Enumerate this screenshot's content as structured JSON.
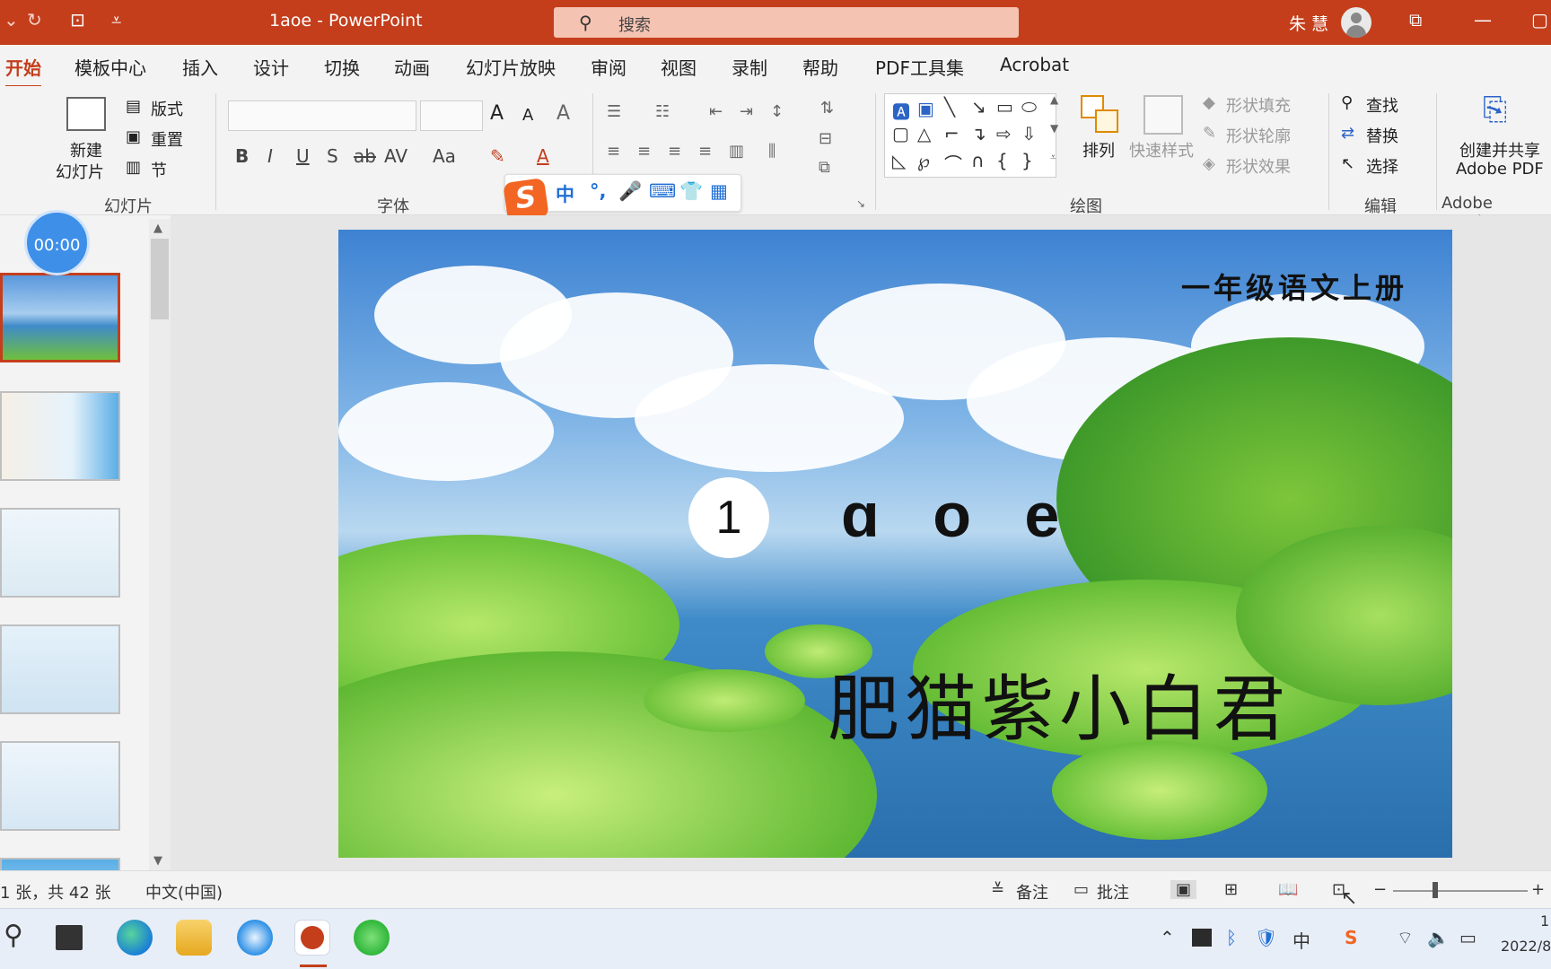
{
  "titlebar": {
    "doc_title": "1aoe  -  PowerPoint",
    "search_placeholder": "搜索",
    "user_name": "朱 慧",
    "undo_icon": "undo-icon",
    "redo_icon": "redo-icon"
  },
  "tabs": [
    "开始",
    "模板中心",
    "插入",
    "设计",
    "切换",
    "动画",
    "幻灯片放映",
    "审阅",
    "视图",
    "录制",
    "帮助",
    "PDF工具集",
    "Acrobat"
  ],
  "ribbon": {
    "slides": {
      "new_slide": "新建",
      "new_slide2": "幻灯片",
      "layout": "版式",
      "reset": "重置",
      "section": "节",
      "group": "幻灯片"
    },
    "font": {
      "group": "字体",
      "bold": "B",
      "italic": "I",
      "underline": "U",
      "shadow": "S",
      "strike": "ab",
      "spacing": "AV",
      "case": "Aa",
      "grow": "A",
      "shrink": "A",
      "clear": "A"
    },
    "drawing": {
      "group": "绘图",
      "arrange": "排列",
      "quick_styles": "快速样式",
      "fill": "形状填充",
      "outline": "形状轮廓",
      "effects": "形状效果"
    },
    "editing": {
      "group": "编辑",
      "find": "查找",
      "replace": "替换",
      "select": "选择"
    },
    "adobe": {
      "create_share": "创建并共享",
      "adobe_pdf": "Adobe PDF",
      "group": "Adobe Acroba"
    }
  },
  "ime": {
    "logo": "S",
    "mode": "中",
    "punct": "°,",
    "voice": "🎤",
    "keyboard": "⌨",
    "skin": "👕",
    "tools": "▦"
  },
  "timer": "00:00",
  "slide": {
    "subtitle": "一年级语文上册",
    "number": "1",
    "letters": "ɑ o e",
    "title": "肥猫紫小白君"
  },
  "statusbar": {
    "slide_count": "1 张，共 42 张",
    "language": "中文(中国)",
    "notes": "备注",
    "comments": "批注",
    "zoom_minus": "−",
    "zoom_plus": "+"
  },
  "taskbar": {
    "clock": "1",
    "date": "2022/8"
  }
}
